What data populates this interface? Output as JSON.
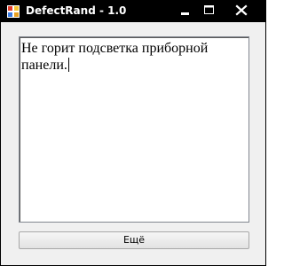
{
  "window": {
    "title": "DefectRand - 1.0"
  },
  "title_buttons": {
    "minimize_icon": "minimize-icon",
    "maximize_icon": "maximize-icon",
    "close_icon": "close-icon"
  },
  "editor": {
    "text": "Не горит подсветка приборной панели."
  },
  "actions": {
    "more_label": "Ещё"
  },
  "colors": {
    "titlebar": "#000000",
    "window_bg": "#f0f0f0",
    "text_bg": "#ffffff"
  }
}
